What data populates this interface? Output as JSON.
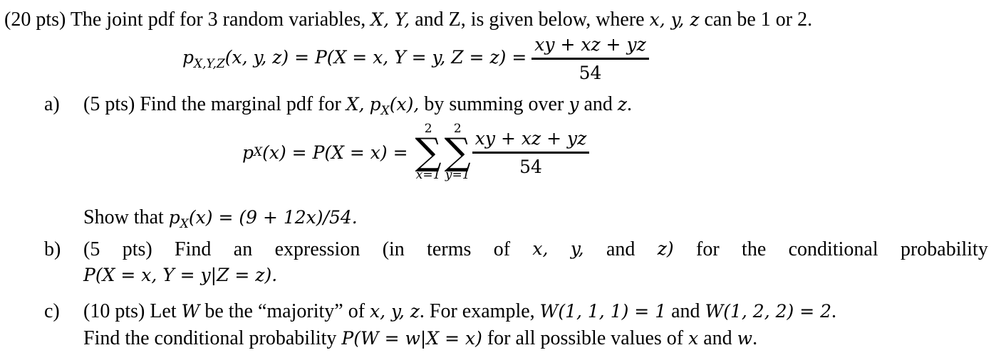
{
  "problem": {
    "intro": {
      "points": "(20 pts)",
      "text_1": " The joint pdf for 3 random variables, ",
      "vars_upper": "X, Y,",
      "text_2": " and Z, is given below, where ",
      "vars_lower": "x, y, z",
      "text_3": " can be 1 or 2."
    },
    "joint_pdf": {
      "lhs_p": "p",
      "lhs_sub": "X,Y,Z",
      "lhs_args": "(x, y, z) = P(X = x, Y = y, Z = z) =",
      "numerator": "xy + xz + yz",
      "denominator": "54"
    },
    "part_a": {
      "label": "a)",
      "text_1": "(5 pts) Find the marginal pdf for ",
      "var_X": "X,",
      "px": "p",
      "px_sub": "X",
      "px_args": "(x),",
      "text_2": " by summing over ",
      "var_y": "y",
      "text_3": " and ",
      "var_z": "z",
      "text_4": ".",
      "equation": {
        "lhs_p": "p",
        "lhs_sub": "X",
        "lhs_rest": "(x) = P(X = x) =",
        "sum1_upper": "2",
        "sum1_lower": "x=1",
        "sum2_upper": "2",
        "sum2_lower": "y=1",
        "numerator": "xy + xz + yz",
        "denominator": "54"
      },
      "show_text": "Show that ",
      "show_p": "p",
      "show_sub": "X",
      "show_expr": "(x) = (9 + 12x)/54."
    },
    "part_b": {
      "label": "b)",
      "words": [
        "(5",
        "pts)",
        "Find",
        "an",
        "expression",
        "(in",
        "terms",
        "of",
        "x,",
        "y,",
        "and",
        "z)",
        "for",
        "the",
        "conditional",
        "probability"
      ],
      "line_2": "P(X = x, Y = y|Z = z)."
    },
    "part_c": {
      "label": "c)",
      "text_1": "(10 pts) Let ",
      "var_W": "W",
      "text_2": " be the “majority” of ",
      "vars": "x, y, z",
      "text_3": ". For example, ",
      "ex1": "W(1, 1, 1) = 1",
      "text_4": " and ",
      "ex2": "W(1, 2, 2) = 2",
      "text_5": ".",
      "line_2_text_1": "Find the conditional probability ",
      "line_2_expr": "P(W = w|X = x)",
      "line_2_text_2": " for all possible values of ",
      "var_x": "x",
      "line_2_text_3": " and ",
      "var_w": "w",
      "line_2_text_4": "."
    }
  }
}
